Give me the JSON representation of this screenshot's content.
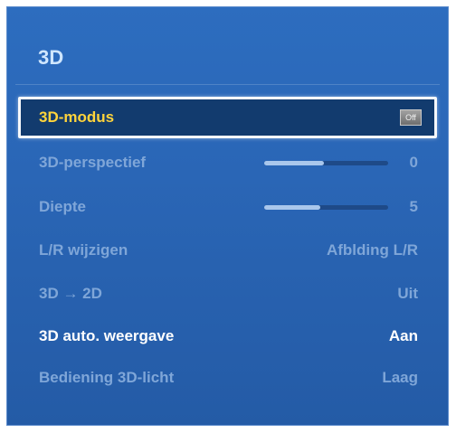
{
  "menu": {
    "title": "3D",
    "items": [
      {
        "label": "3D-modus",
        "value": "Off"
      },
      {
        "label": "3D-perspectief",
        "value": "0",
        "slider_fraction": 0.48
      },
      {
        "label": "Diepte",
        "value": "5",
        "slider_fraction": 0.45
      },
      {
        "label": "L/R wijzigen",
        "value": "Afblding L/R"
      },
      {
        "label": "3D → 2D",
        "value": "Uit"
      },
      {
        "label": "3D auto. weergave",
        "value": "Aan"
      },
      {
        "label": "Bediening 3D-licht",
        "value": "Laag"
      }
    ]
  },
  "colors": {
    "panel": "#2a66b6",
    "selected_bg": "#123b6e",
    "selected_text": "#ffd43b",
    "dim_text": "#7fa6d8",
    "title_text": "#cfe6ff"
  }
}
